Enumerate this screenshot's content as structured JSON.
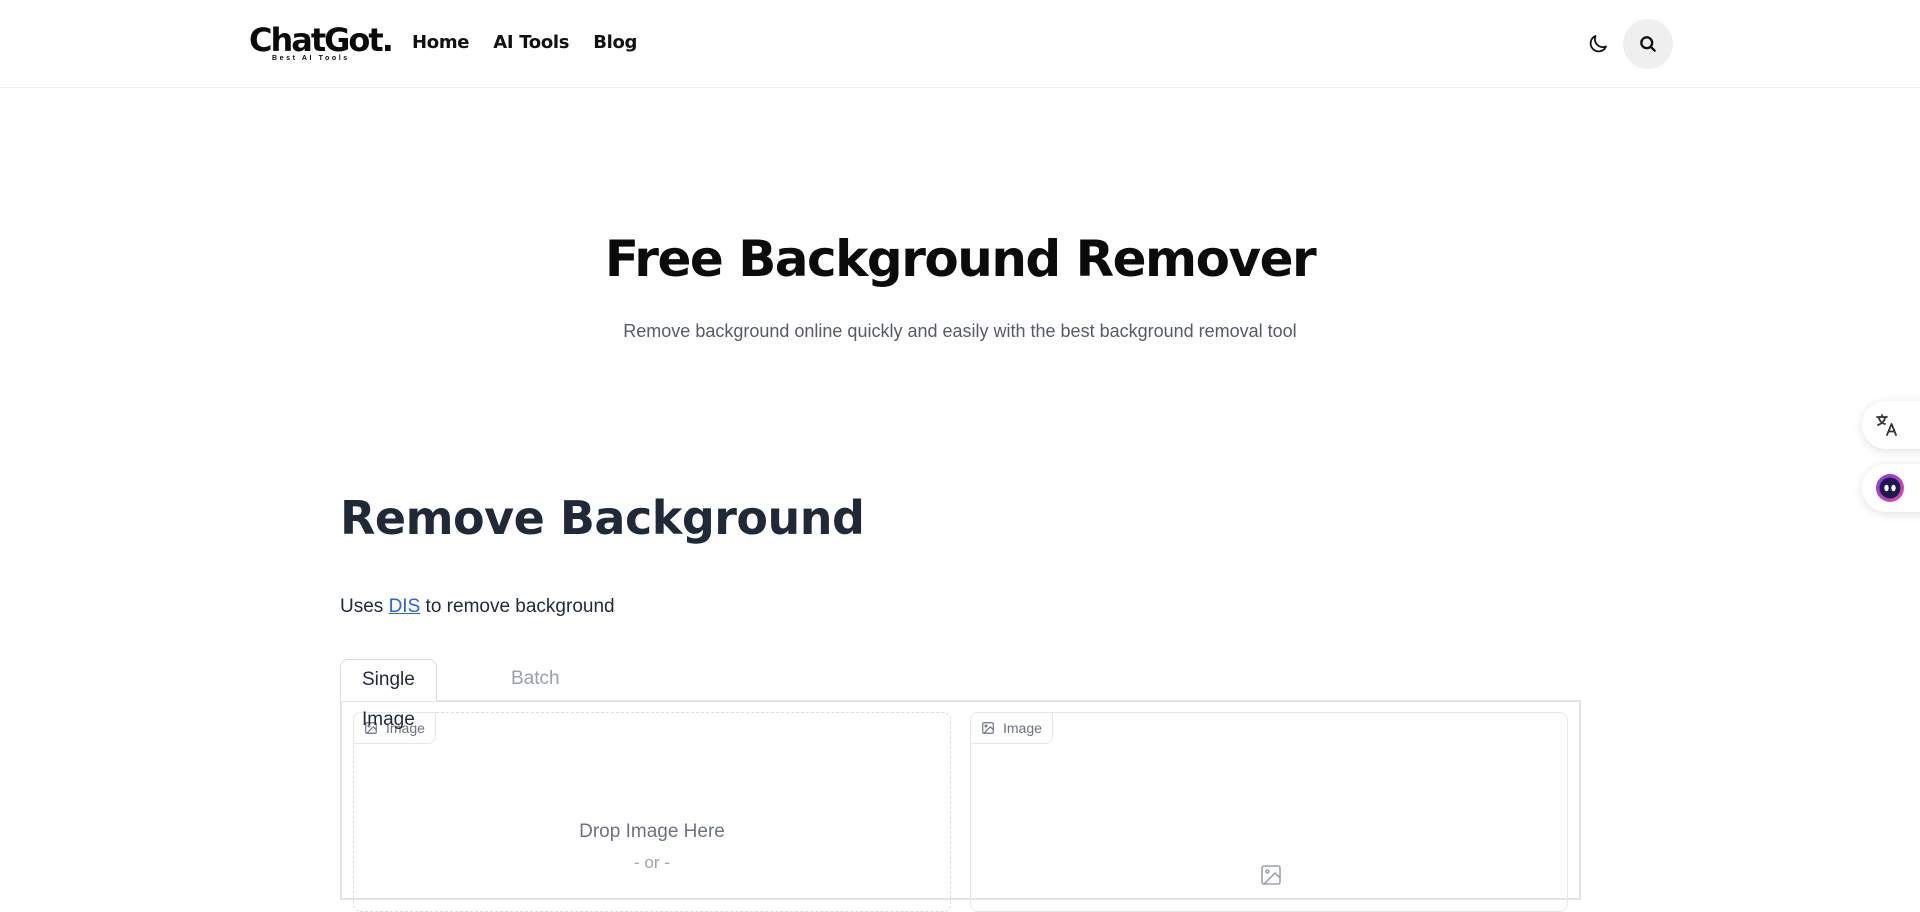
{
  "brand": {
    "name": "ChatGot.",
    "tagline": "Best AI Tools"
  },
  "nav": {
    "items": [
      {
        "label": "Home"
      },
      {
        "label": "AI Tools"
      },
      {
        "label": "Blog"
      }
    ]
  },
  "icons": {
    "theme": "moon-icon",
    "search": "search-icon",
    "translate": "translate-icon",
    "assistant": "assistant-bot-icon",
    "image": "image-icon"
  },
  "hero": {
    "title": "Free Background Remover",
    "subtitle": "Remove background online quickly and easily with the best background removal tool"
  },
  "app": {
    "title": "Remove Background",
    "desc_prefix": "Uses ",
    "desc_link": "DIS",
    "desc_suffix": " to remove background",
    "tabs": [
      {
        "label": "Single Image",
        "active": true
      },
      {
        "label": "Batch",
        "active": false
      }
    ],
    "input_box": {
      "label": "Image",
      "drop_text": "Drop Image Here",
      "or_text": "- or -"
    },
    "output_box": {
      "label": "Image"
    }
  },
  "colors": {
    "link": "#2563eb",
    "heading": "#1f2937",
    "muted": "#6b7280",
    "search_bg": "#efefef"
  }
}
